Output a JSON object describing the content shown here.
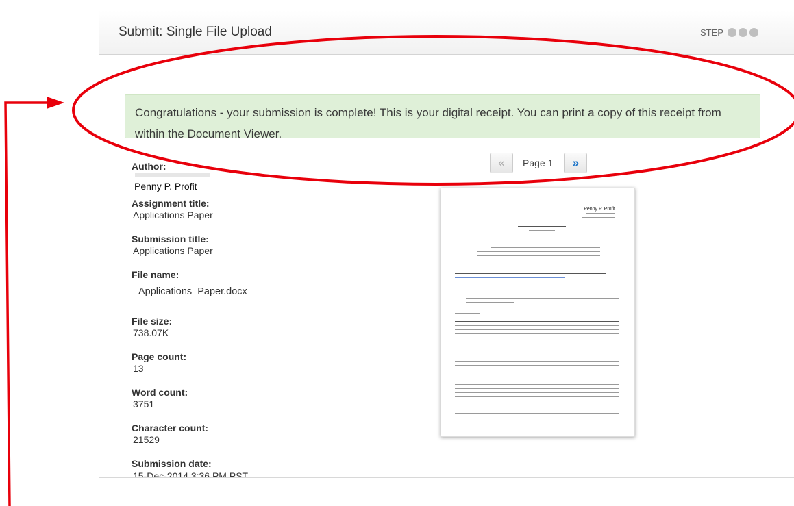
{
  "panel": {
    "title": "Submit: Single File Upload",
    "step_label": "STEP"
  },
  "alert": {
    "message": "Congratulations - your submission is complete! This is your digital receipt. You can print a copy of this receipt from within the Document Viewer."
  },
  "pager": {
    "prev_glyph": "«",
    "page_label": "Page 1",
    "next_glyph": "»"
  },
  "meta": {
    "author_label": "Author:",
    "author_value": "Penny P. Profit",
    "assignment_title_label": "Assignment title:",
    "assignment_title_value": "Applications Paper",
    "submission_title_label": "Submission title:",
    "submission_title_value": "Applications Paper",
    "file_name_label": "File name:",
    "file_name_value": "Applications_Paper.docx",
    "file_size_label": "File size:",
    "file_size_value": "738.07K",
    "page_count_label": "Page count:",
    "page_count_value": "13",
    "word_count_label": "Word count:",
    "word_count_value": "3751",
    "character_count_label": "Character count:",
    "character_count_value": "21529",
    "submission_date_label": "Submission date:",
    "submission_date_value": "15-Dec-2014 3:36 PM PST"
  },
  "preview": {
    "author": "Penny P. Profit"
  },
  "colors": {
    "alert_bg": "#dff0d8",
    "annotation_red": "#e8000b",
    "next_blue": "#1a73c8"
  }
}
